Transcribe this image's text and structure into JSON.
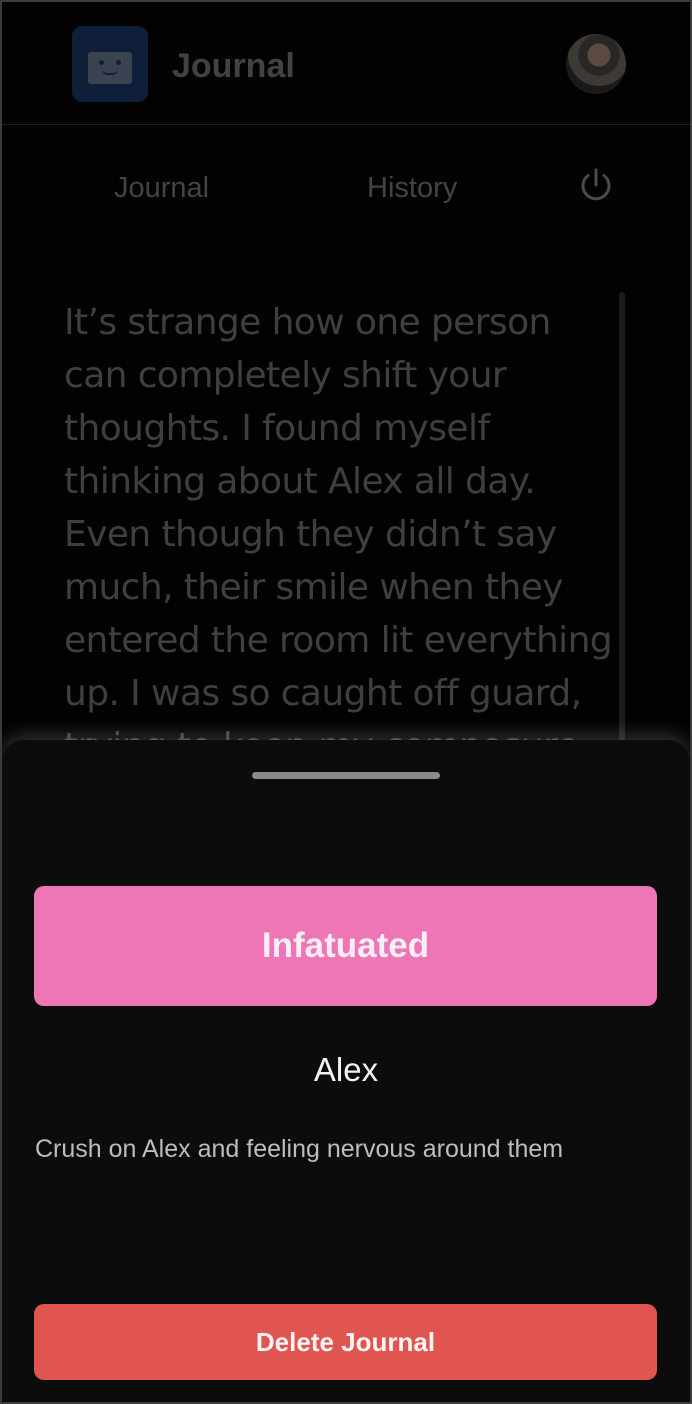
{
  "header": {
    "app_title": "Journal",
    "logo_icon": "robot-face-icon",
    "avatar_icon": "user-avatar"
  },
  "nav": {
    "tabs": [
      {
        "label": "Journal"
      },
      {
        "label": "History"
      }
    ],
    "power_icon": "power-icon"
  },
  "journal": {
    "text": "It’s strange how one person can completely shift your thoughts. I found myself thinking about Alex all day. Even though they didn’t say much, their smile when they entered the room lit everything up. I was so caught off guard, trying to keep my composure"
  },
  "sheet": {
    "mood_label": "Infatuated",
    "person": "Alex",
    "summary": "Crush on Alex and feeling nervous around them",
    "delete_label": "Delete Journal"
  },
  "colors": {
    "mood": "#ee76b6",
    "delete": "#e0554f",
    "sheet_bg": "#0c0c0c"
  }
}
